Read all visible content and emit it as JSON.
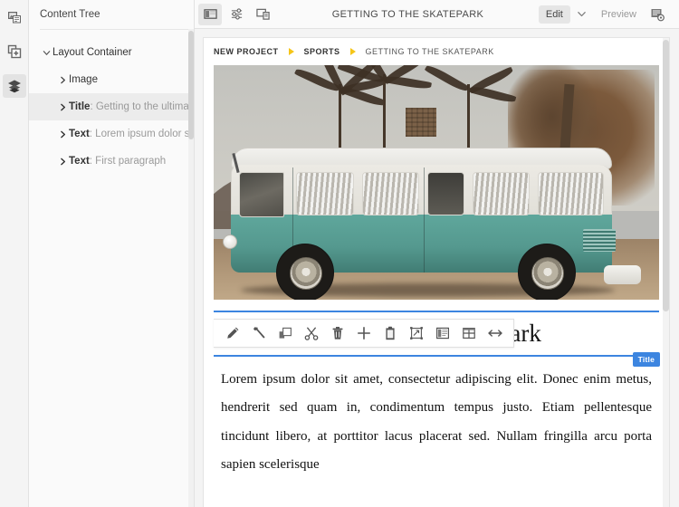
{
  "rail": {
    "items": [
      {
        "name": "media-library-icon",
        "title": "Media"
      },
      {
        "name": "add-content-icon",
        "title": "Add content"
      },
      {
        "name": "layers-icon",
        "title": "Layers",
        "active": true
      }
    ]
  },
  "tree_panel": {
    "header": "Content Tree",
    "items": [
      {
        "label": "Layout Container",
        "sub": "",
        "depth": 0,
        "expanded": true,
        "selected": false
      },
      {
        "label": "Image",
        "sub": "",
        "depth": 1,
        "expanded": false,
        "selected": false
      },
      {
        "label": "Title",
        "sub": ": Getting to the ultimate ska",
        "depth": 1,
        "expanded": false,
        "selected": true
      },
      {
        "label": "Text",
        "sub": ": Lorem ipsum dolor sit am",
        "depth": 1,
        "expanded": false,
        "selected": false
      },
      {
        "label": "Text",
        "sub": ": First paragraph",
        "depth": 1,
        "expanded": false,
        "selected": false
      }
    ]
  },
  "topbar": {
    "left_icons": [
      {
        "name": "toggle-sidebar-icon",
        "active": true
      },
      {
        "name": "settings-sliders-icon",
        "active": false
      },
      {
        "name": "responsive-device-icon",
        "active": false
      }
    ],
    "title": "GETTING TO THE SKATEPARK",
    "edit_label": "Edit",
    "caret_icon": "chevron-down-icon",
    "preview_label": "Preview",
    "right_icon": "page-settings-icon"
  },
  "breadcrumb": {
    "items": [
      "NEW PROJECT",
      "SPORTS",
      "GETTING TO THE SKATEPARK"
    ],
    "separator_color": "#f5c518"
  },
  "element_toolbar": {
    "buttons": [
      {
        "name": "edit-pencil-icon",
        "label": "Edit"
      },
      {
        "name": "wrench-settings-icon",
        "label": "Settings"
      },
      {
        "name": "duplicate-icon",
        "label": "Duplicate"
      },
      {
        "name": "cut-scissors-icon",
        "label": "Cut"
      },
      {
        "name": "delete-trash-icon",
        "label": "Delete"
      },
      {
        "name": "add-plus-icon",
        "label": "Add"
      },
      {
        "name": "paste-clipboard-icon",
        "label": "Paste"
      },
      {
        "name": "resize-transform-icon",
        "label": "Resize"
      },
      {
        "name": "columns-layout-icon",
        "label": "Columns"
      },
      {
        "name": "grid-table-icon",
        "label": "Grid"
      },
      {
        "name": "horizontal-resize-icon",
        "label": "Stretch"
      }
    ]
  },
  "content": {
    "image_alt": "Teal Volkswagen van parked under palm trees",
    "title": "Getting to the ultimate skatepark",
    "title_badge": "Title",
    "paragraph": "Lorem ipsum dolor sit amet, consectetur adipiscing elit. Donec enim metus, hendrerit sed quam in, condimentum tempus justo. Etiam pellentesque tincidunt libero, at porttitor lacus placerat sed. Nullam fringilla arcu porta sapien scelerisque"
  },
  "colors": {
    "accent_blue": "#3c85e0",
    "breadcrumb_yellow": "#f5c518",
    "van_teal": "#55998f",
    "panel_bg": "#fafafa"
  }
}
